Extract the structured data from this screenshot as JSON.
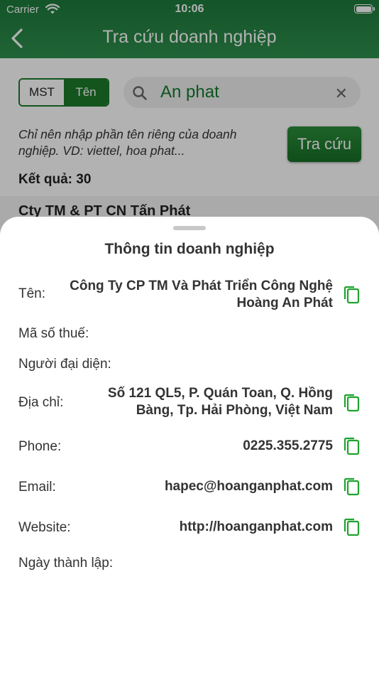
{
  "status": {
    "carrier": "Carrier",
    "time": "10:06"
  },
  "header": {
    "title": "Tra cứu doanh nghiệp"
  },
  "search": {
    "mode_mst": "MST",
    "mode_ten": "Tên",
    "query": "An phat",
    "hint_line1": "Chỉ nên nhập phần tên riêng của doanh",
    "hint_line2": "nghiệp. VD: viettel, hoa phat...",
    "button": "Tra cứu"
  },
  "results": {
    "count_label": "Kết quả: 30",
    "first_name": "Cty TM & PT CN Tấn Phát"
  },
  "sheet": {
    "title": "Thông tin doanh nghiệp",
    "ten_label": "Tên:",
    "ten_value_line1": "Công Ty CP TM Và Phát Triển Công Nghệ",
    "ten_value_line2": "Hoàng An Phát",
    "mst_label": "Mã số thuế:",
    "nguoi_dai_dien_label": "Người đại diện:",
    "dia_chi_label": "Địa chỉ:",
    "dia_chi_value_line1": "Số 121 QL5, P. Quán Toan, Q. Hồng",
    "dia_chi_value_line2": "Bàng, Tp. Hải Phòng, Việt Nam",
    "phone_label": "Phone:",
    "phone_value": "0225.355.2775",
    "email_label": "Email:",
    "email_value": "hapec@hoanganphat.com",
    "website_label": "Website:",
    "website_value": "http://hoanganphat.com",
    "ngay_thanh_lap_label": "Ngày thành lập:"
  },
  "colors": {
    "brand_green": "#1c7a2a",
    "header_green": "#1d7a3b",
    "copy_icon": "#1fa32e"
  },
  "icons": [
    "wifi-icon",
    "battery-icon",
    "back-chevron-icon",
    "search-icon",
    "clear-icon",
    "copy-icon"
  ]
}
